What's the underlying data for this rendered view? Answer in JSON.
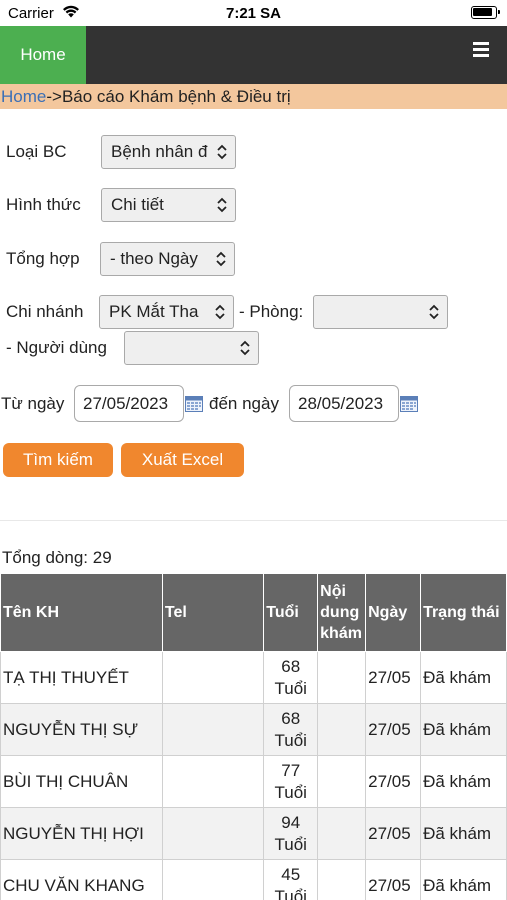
{
  "status_bar": {
    "carrier": "Carrier",
    "time": "7:21 SA"
  },
  "nav": {
    "home_label": "Home",
    "menu_icon": "hamburger-menu-icon"
  },
  "breadcrumb": {
    "home": "Home",
    "separator": "->",
    "current": "Báo cáo Khám bệnh & Điều trị"
  },
  "form": {
    "report_type": {
      "label": "Loại BC",
      "value": "Bệnh nhân đ"
    },
    "format": {
      "label": "Hình thức",
      "value": "Chi tiết"
    },
    "grouping": {
      "label": "Tổng hợp",
      "value": "- theo Ngày"
    },
    "branch": {
      "label": "Chi nhánh",
      "value": "PK Mắt Tha"
    },
    "room": {
      "label": "- Phòng:",
      "value": ""
    },
    "user": {
      "label": "- Người dùng",
      "value": ""
    },
    "date_from": {
      "label": "Từ ngày",
      "value": "27/05/2023"
    },
    "date_to": {
      "label": "đến ngày",
      "value": "28/05/2023"
    },
    "search_button": "Tìm kiếm",
    "export_button": "Xuất Excel"
  },
  "results": {
    "total_label": "Tổng dòng: 29",
    "columns": [
      "Tên KH",
      "Tel",
      "Tuổi",
      "Nội dung khám",
      "Ngày",
      "Trạng thái"
    ],
    "rows": [
      {
        "name": "TẠ THỊ THUYẾT",
        "tel": "",
        "age": "68 Tuổi",
        "content": "",
        "date": "27/05",
        "status": "Đã khám"
      },
      {
        "name": "NGUYỄN THỊ SỰ",
        "tel": "",
        "age": "68 Tuổi",
        "content": "",
        "date": "27/05",
        "status": "Đã khám"
      },
      {
        "name": "BÙI THỊ CHUÂN",
        "tel": "",
        "age": "77 Tuổi",
        "content": "",
        "date": "27/05",
        "status": "Đã khám"
      },
      {
        "name": "NGUYỄN THỊ HỢI",
        "tel": "",
        "age": "94 Tuổi",
        "content": "",
        "date": "27/05",
        "status": "Đã khám"
      },
      {
        "name": "CHU VĂN KHANG",
        "tel": "",
        "age": "45 Tuổi",
        "content": "",
        "date": "27/05",
        "status": "Đã khám"
      }
    ]
  }
}
